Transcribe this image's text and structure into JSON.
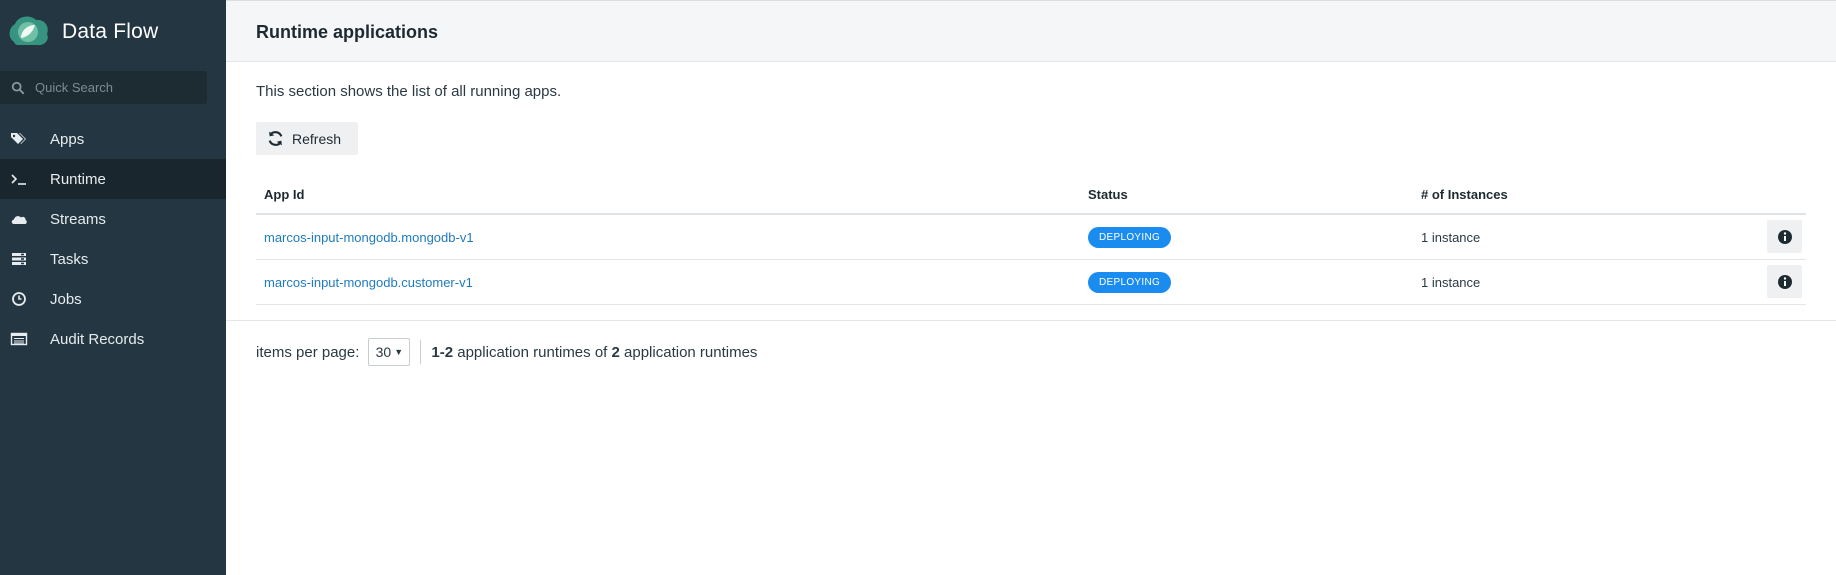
{
  "app": {
    "title": "Data Flow"
  },
  "search": {
    "placeholder": "Quick Search"
  },
  "sidebar": {
    "items": [
      {
        "label": "Apps",
        "icon": "tags-icon"
      },
      {
        "label": "Runtime",
        "icon": "terminal-icon",
        "active": true
      },
      {
        "label": "Streams",
        "icon": "cloud-icon"
      },
      {
        "label": "Tasks",
        "icon": "tasks-icon"
      },
      {
        "label": "Jobs",
        "icon": "clock-icon"
      },
      {
        "label": "Audit Records",
        "icon": "list-icon"
      }
    ]
  },
  "header": {
    "title": "Runtime applications"
  },
  "main": {
    "description": "This section shows the list of all running apps.",
    "refresh_label": "Refresh",
    "table": {
      "columns": [
        "App Id",
        "Status",
        "# of Instances"
      ],
      "rows": [
        {
          "app_id": "marcos-input-mongodb.mongodb-v1",
          "status": "DEPLOYING",
          "instances": "1 instance"
        },
        {
          "app_id": "marcos-input-mongodb.customer-v1",
          "status": "DEPLOYING",
          "instances": "1 instance"
        }
      ]
    }
  },
  "pagination": {
    "items_per_page_label": "items per page:",
    "page_size": "30",
    "range": "1-2",
    "text_mid": "application runtimes of",
    "total": "2",
    "text_end": "application runtimes"
  },
  "colors": {
    "sidebar_bg": "#243641",
    "badge_blue": "#1a8cf0",
    "link_blue": "#1f7bbf"
  }
}
